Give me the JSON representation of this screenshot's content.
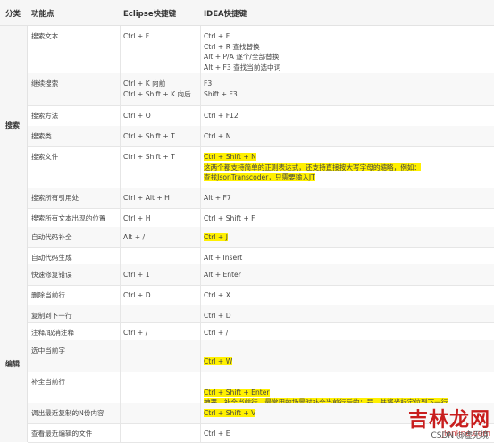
{
  "header": {
    "category": "分类",
    "feature": "功能点",
    "eclipse": "Eclipse快捷键",
    "idea": "IDEA快捷键"
  },
  "categories": [
    {
      "label": "搜索"
    },
    {
      "label": "编辑"
    }
  ],
  "rows": [
    {
      "feature": "搜索文本",
      "eclipse": [
        "Ctrl + F"
      ],
      "idea": [
        {
          "t": "Ctrl + F"
        },
        {
          "t": "Ctrl + R 查找替换"
        },
        {
          "t": "Alt + P/A 逐个/全部替换"
        },
        {
          "t": "Alt + F3 查找当前选中词"
        }
      ]
    },
    {
      "feature": "继续搜索",
      "eclipse": [
        "Ctrl + K 向前",
        "Ctrl + Shift + K 向后"
      ],
      "idea": [
        {
          "t": "F3"
        },
        {
          "t": "Shift + F3"
        }
      ]
    },
    {
      "feature": "搜索方法",
      "eclipse": [
        "Ctrl + O"
      ],
      "idea": [
        {
          "t": "Ctrl + F12"
        }
      ]
    },
    {
      "feature": "搜索类",
      "eclipse": [
        "Ctrl + Shift + T"
      ],
      "idea": [
        {
          "t": "Ctrl + N"
        }
      ]
    },
    {
      "feature": "搜索文件",
      "eclipse": [
        "Ctrl + Shift + T"
      ],
      "idea": [
        {
          "t": "Ctrl + Shift + N",
          "hl": true
        },
        {
          "t": "这两个都支持简单的正则表达式，还支持直接按大写字母的缩略，例如：",
          "hl": true
        },
        {
          "t": "查找JsonTranscoder，只需要输入JT",
          "hl": true
        }
      ]
    },
    {
      "feature": "搜索所有引用处",
      "eclipse": [
        "Ctrl + Alt + H"
      ],
      "idea": [
        {
          "t": "Alt + F7"
        }
      ]
    },
    {
      "feature": "搜索所有文本出现的位置",
      "eclipse": [
        "Ctrl + H"
      ],
      "idea": [
        {
          "t": "Ctrl + Shift + F"
        }
      ]
    },
    {
      "feature": "自动代码补全",
      "eclipse": [
        "Alt + /"
      ],
      "idea": [
        {
          "t": "Ctrl + J",
          "hl": true
        }
      ]
    },
    {
      "feature": "自动代码生成",
      "eclipse": [],
      "idea": [
        {
          "t": "Alt + Insert"
        }
      ]
    },
    {
      "feature": "快速修复错误",
      "eclipse": [
        "Ctrl + 1"
      ],
      "idea": [
        {
          "t": "Alt + Enter"
        }
      ]
    },
    {
      "feature": "删除当前行",
      "eclipse": [
        "Ctrl + D"
      ],
      "idea": [
        {
          "t": "Ctrl + X"
        }
      ]
    },
    {
      "feature": "复制到下一行",
      "eclipse": [],
      "idea": [
        {
          "t": "Ctrl + D"
        }
      ]
    },
    {
      "feature": "注释/取消注释",
      "eclipse": [
        "Ctrl + /"
      ],
      "idea": [
        {
          "t": "Ctrl + /"
        }
      ]
    },
    {
      "feature": "选中当前字",
      "eclipse": [],
      "idea": [
        {
          "t": ""
        },
        {
          "t": "Ctrl + W",
          "hl": true
        }
      ]
    },
    {
      "feature": "补全当前行",
      "eclipse": [],
      "idea": [
        {
          "t": ""
        },
        {
          "t": "Ctrl + Shift + Enter",
          "hl": true
        },
        {
          "t": "神器，补全当前行，最常用的场景时补全当前行后的；号，并将光标定位到下一行",
          "hl": true
        }
      ]
    },
    {
      "feature": "调出最近复制的N份内容",
      "eclipse": [],
      "idea": [
        {
          "t": "Ctrl + Shift + V",
          "hl": true
        }
      ]
    },
    {
      "feature": "查看最近编辑的文件",
      "eclipse": [],
      "idea": [
        {
          "t": "Ctrl + E"
        }
      ]
    }
  ],
  "watermark": {
    "logo": "吉林龙网",
    "sub": "jlonline.com",
    "csdn": "CSDN @虚无境"
  }
}
